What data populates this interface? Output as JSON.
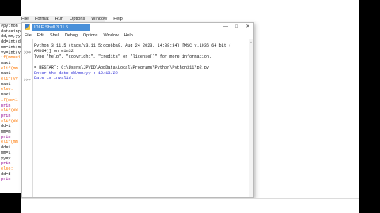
{
  "editor": {
    "menu_items": [
      "File",
      "Format",
      "Run",
      "Options",
      "Window",
      "Help"
    ],
    "code_lines": [
      {
        "text": "#python",
        "color": "#111111"
      },
      {
        "text": "date=inp",
        "color": "#111111"
      },
      {
        "text": "dd,mm,yy",
        "color": "#111111"
      },
      {
        "text": "dd=int(d",
        "color": "#111111"
      },
      {
        "text": "mm=int(m",
        "color": "#111111"
      },
      {
        "text": "yy=int(y",
        "color": "#111111"
      },
      {
        "text": "if(mm==1",
        "color": "#ff7700"
      },
      {
        "text": "    max1",
        "color": "#111111"
      },
      {
        "text": "elif(mm",
        "color": "#ff7700"
      },
      {
        "text": "    max1",
        "color": "#111111"
      },
      {
        "text": "elif(yy",
        "color": "#ff7700"
      },
      {
        "text": "    max1",
        "color": "#111111"
      },
      {
        "text": "else:",
        "color": "#ff7700"
      },
      {
        "text": "    max1",
        "color": "#111111"
      },
      {
        "text": "if(mm<1",
        "color": "#ff7700"
      },
      {
        "text": "    prin",
        "color": "#900090"
      },
      {
        "text": "elif(dd",
        "color": "#ff7700"
      },
      {
        "text": "    prin",
        "color": "#900090"
      },
      {
        "text": "elif(dd",
        "color": "#ff7700"
      },
      {
        "text": "    dd=1",
        "color": "#111111"
      },
      {
        "text": "    mm=m",
        "color": "#111111"
      },
      {
        "text": "    prin",
        "color": "#900090"
      },
      {
        "text": "elif(mm",
        "color": "#ff7700"
      },
      {
        "text": "    dd=1",
        "color": "#111111"
      },
      {
        "text": "    mm=1",
        "color": "#111111"
      },
      {
        "text": "    yy=y",
        "color": "#111111"
      },
      {
        "text": "    prin",
        "color": "#900090"
      },
      {
        "text": "else:",
        "color": "#ff7700"
      },
      {
        "text": "    dd=d",
        "color": "#111111"
      },
      {
        "text": "    prin",
        "color": "#900090"
      }
    ]
  },
  "shell": {
    "title": "IDLE Shell 3.11.5",
    "min_glyph": "—",
    "max_glyph": "□",
    "close_glyph": "✕",
    "menu_items": [
      "File",
      "Edit",
      "Shell",
      "Debug",
      "Options",
      "Window",
      "Help"
    ],
    "prompts": [
      ">>>",
      ">>>"
    ],
    "lines": [
      {
        "text": "Python 3.11.5 (tags/v3.11.5:cce6ba9, Aug 24 2023, 14:38:34) [MSC v.1936 64 bit (",
        "style": "black"
      },
      {
        "text": "AMD64)] on win32",
        "style": "black"
      },
      {
        "text": "Type \"help\", \"copyright\", \"credits\" or \"license()\" for more information.",
        "style": "black"
      },
      {
        "text": "",
        "style": "black"
      },
      {
        "text": "= RESTART: C:\\Users\\JPVDD\\AppData\\Local\\Programs\\Python\\Python311\\p2.py",
        "style": "black"
      },
      {
        "text": "Enter the date dd/mm/yy : 12/13/22",
        "style": "blue"
      },
      {
        "text": "Date is invalid.",
        "style": "blue"
      }
    ]
  }
}
